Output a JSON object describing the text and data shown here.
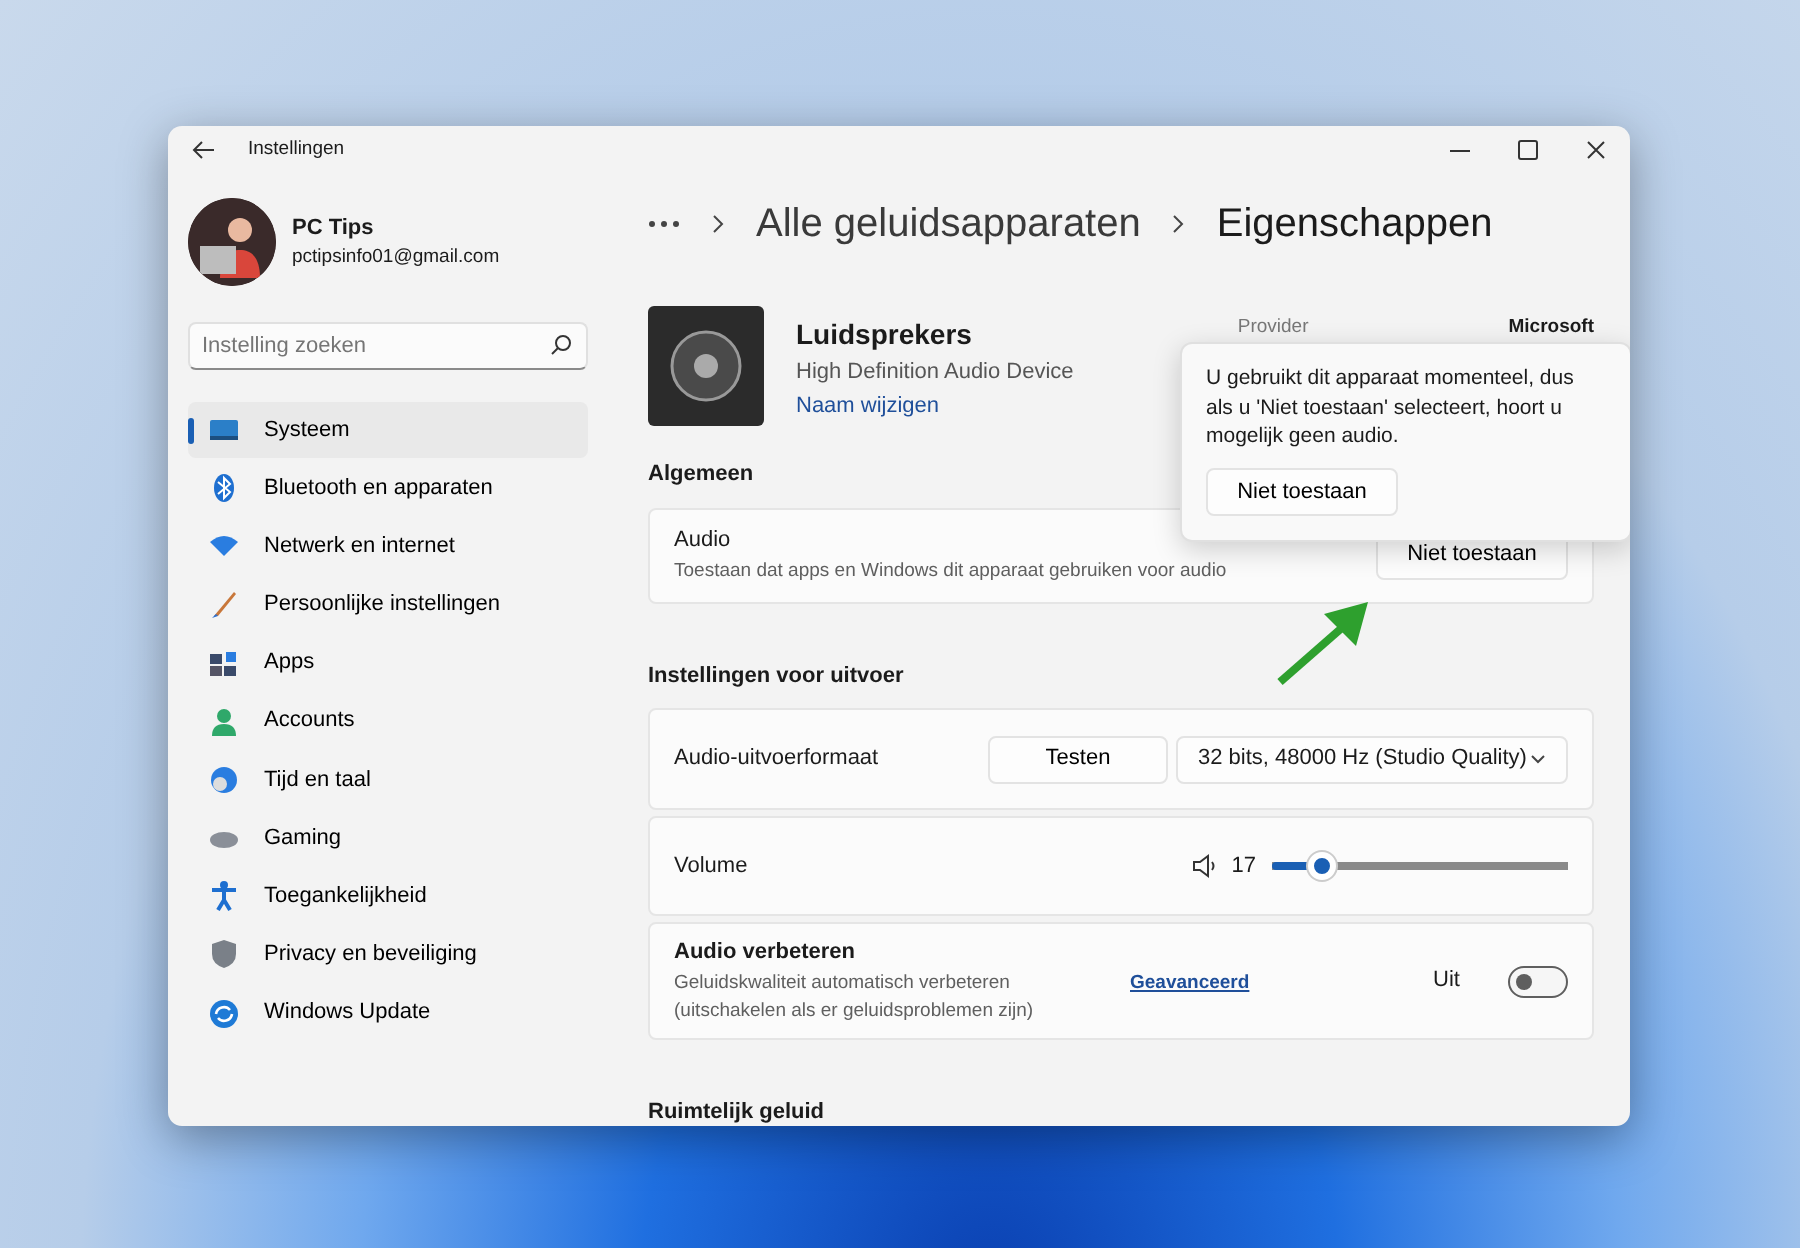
{
  "window": {
    "title": "Instellingen"
  },
  "user": {
    "name": "PC Tips",
    "email": "pctipsinfo01@gmail.com"
  },
  "search": {
    "placeholder": "Instelling zoeken"
  },
  "sidebar": {
    "items": [
      {
        "label": "Systeem",
        "selected": true
      },
      {
        "label": "Bluetooth en apparaten",
        "selected": false
      },
      {
        "label": "Netwerk en internet",
        "selected": false
      },
      {
        "label": "Persoonlijke instellingen",
        "selected": false
      },
      {
        "label": "Apps",
        "selected": false
      },
      {
        "label": "Accounts",
        "selected": false
      },
      {
        "label": "Tijd en taal",
        "selected": false
      },
      {
        "label": "Gaming",
        "selected": false
      },
      {
        "label": "Toegankelijkheid",
        "selected": false
      },
      {
        "label": "Privacy en beveiliging",
        "selected": false
      },
      {
        "label": "Windows Update",
        "selected": false
      }
    ]
  },
  "breadcrumb": [
    "Alle geluidsapparaten",
    "Eigenschappen"
  ],
  "device": {
    "name": "Luidsprekers",
    "description": "High Definition Audio Device",
    "rename_link": "Naam wijzigen",
    "provider_label": "Provider",
    "provider_value": "Microsoft"
  },
  "flyout": {
    "message": "U gebruikt dit apparaat momenteel, dus als u 'Niet toestaan' selecteert, hoort u mogelijk geen audio.",
    "button": "Niet toestaan"
  },
  "sections": [
    {
      "heading": "Algemeen",
      "rows": [
        {
          "kind": "button",
          "label": "Audio",
          "description": "Toestaan dat apps en Windows dit apparaat gebruiken voor audio",
          "button": "Niet toestaan"
        }
      ]
    },
    {
      "heading": "Instellingen voor uitvoer",
      "rows": [
        {
          "kind": "format",
          "label": "Audio-uitvoerformaat",
          "button": "Testen",
          "value": "32 bits, 48000 Hz (Studio Quality)"
        },
        {
          "kind": "slider",
          "label": "Volume",
          "reading": "17",
          "level": 0.17
        },
        {
          "kind": "toggle",
          "label": "Audio verbeteren",
          "description": "Geluidskwaliteit automatisch verbeteren (uitschakelen als er geluidsproblemen zijn)",
          "link": "Geavanceerd",
          "state_label": "Uit",
          "on": false
        }
      ]
    },
    {
      "heading": "Ruimtelijk geluid"
    }
  ]
}
